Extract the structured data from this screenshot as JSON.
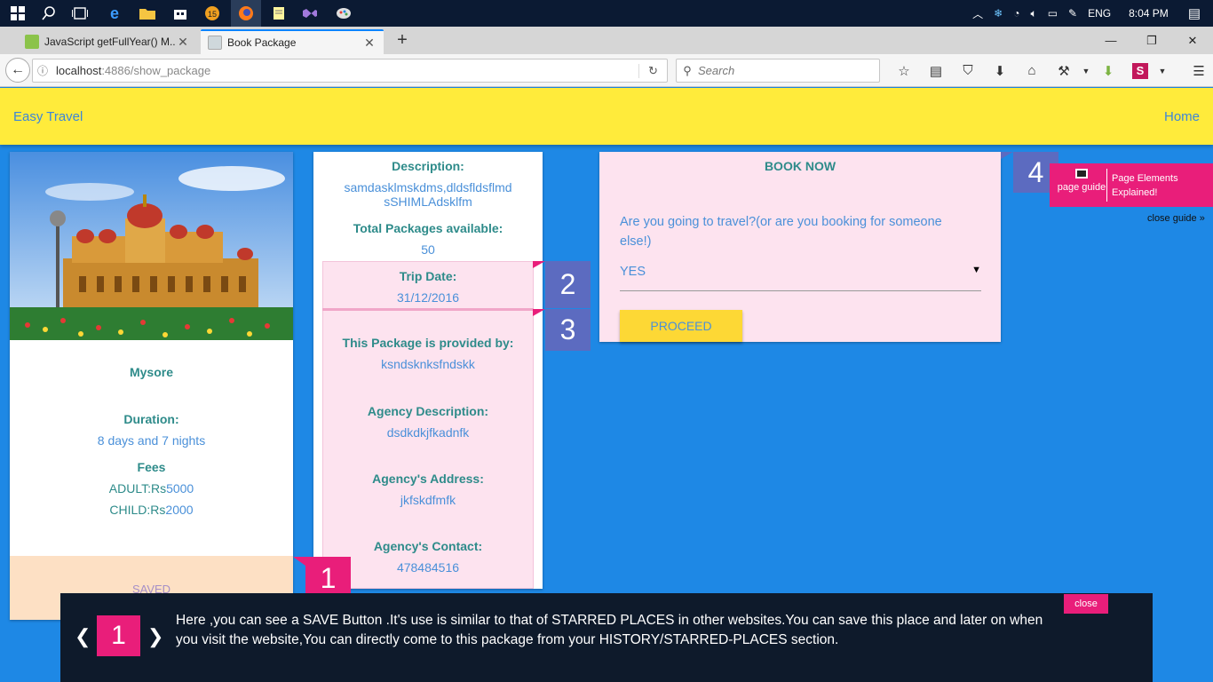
{
  "taskbar": {
    "time": "8:04 PM",
    "language": "ENG",
    "start_icon": "windows-start-icon",
    "search_icon": "search-icon",
    "taskview_icon": "task-view-icon",
    "edge_icon": "edge-icon",
    "explorer_icon": "folder-icon",
    "store_icon": "store-icon",
    "app15_icon": "app-icon",
    "firefox_icon": "firefox-icon",
    "notes_icon": "notepad-icon",
    "vs_icon": "visual-studio-icon",
    "paint_icon": "paint-icon"
  },
  "browser": {
    "tabs": [
      {
        "title": "JavaScript getFullYear() M...",
        "favicon_color": "#8bc34a"
      },
      {
        "title": "Book Package",
        "favicon_color": "#cfd8dc"
      }
    ],
    "url_host": "localhost",
    "url_rest": ":4886/show_package",
    "search_placeholder": "Search"
  },
  "site": {
    "brand": "Easy Travel",
    "home": "Home"
  },
  "place_card": {
    "name": "Mysore",
    "duration_label": "Duration:",
    "duration_value": "8 days and 7 nights",
    "fees_label": "Fees",
    "adult_label": "ADULT:Rs",
    "adult_value": "5000",
    "child_label": "CHILD:Rs",
    "child_value": "2000",
    "saved_label": "SAVED"
  },
  "desc_card": {
    "description_label": "Description:",
    "description_line1": "samdasklmskdms,dldsfldsflmd",
    "description_line2": "sSHIMLAdsklfm",
    "total_label": "Total Packages available:",
    "total_value": "50",
    "trip_date_label": "Trip Date:",
    "trip_date_value": "31/12/2016",
    "provided_label": "This Package is provided by:",
    "provided_value": "ksndsknksfndskk",
    "agency_desc_label": "Agency Description:",
    "agency_desc_value": "dsdkdkjfkadnfk",
    "agency_address_label": "Agency's Address:",
    "agency_address_value": "jkfskdfmfk",
    "agency_contact_label": "Agency's Contact:",
    "agency_contact_value": "478484516"
  },
  "book_card": {
    "title": "BOOK NOW",
    "question": "Are you going to travel?(or are you booking for someone else!)",
    "select_value": "YES",
    "proceed": "PROCEED"
  },
  "guide": {
    "markers": [
      "1",
      "2",
      "3",
      "4"
    ],
    "page_guide": "page guide",
    "page_elements": "Page Elements",
    "explained": "Explained!",
    "close_guide": "close guide »",
    "tooltip_number": "1",
    "tooltip_text": "Here ,you can see a SAVE Button .It's use is similar to that of STARRED PLACES in other websites.You can save this place and later on when you visit the website,You can directly come to this package from your HISTORY/STARRED-PLACES section.",
    "close": "close",
    "prev": "❮",
    "next": "❯"
  }
}
